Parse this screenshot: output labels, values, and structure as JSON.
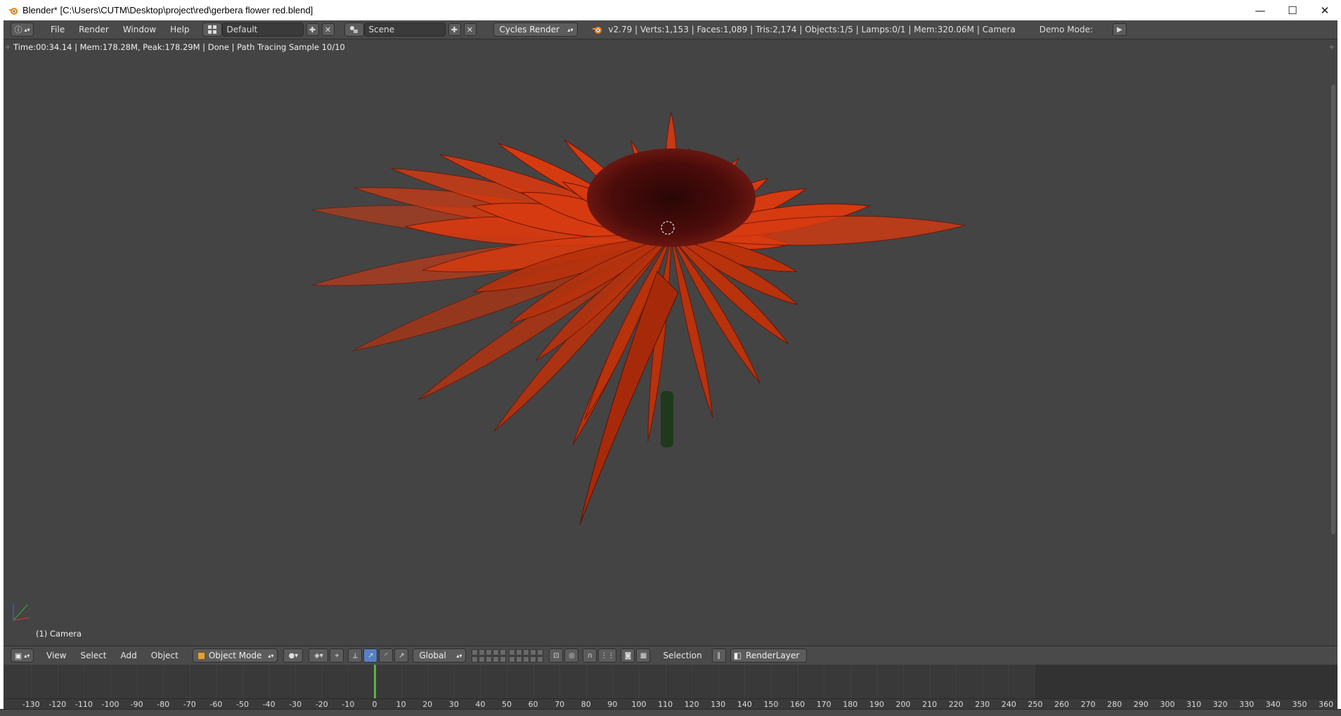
{
  "window": {
    "title": "Blender* [C:\\Users\\CUTM\\Desktop\\project\\red\\gerbera flower red.blend]",
    "minimize_glyph": "—",
    "maximize_glyph": "☐",
    "close_glyph": "✕"
  },
  "info_header": {
    "editor_glyph": "ⓘ",
    "menus": [
      "File",
      "Render",
      "Window",
      "Help"
    ],
    "screen_layout": "Default",
    "scene": "Scene",
    "render_engine": "Cycles Render",
    "stats": "v2.79 | Verts:1,153 | Faces:1,089 | Tris:2,174 | Objects:1/5 | Lamps:0/1 | Mem:320.06M | Camera",
    "demo_mode_label": "Demo Mode:"
  },
  "viewport": {
    "render_status": "Time:00:34.14 | Mem:178.28M, Peak:178.29M | Done | Path Tracing Sample 10/10",
    "camera_label": "(1) Camera",
    "petal_color": "#d63a10",
    "background_color": "#444444"
  },
  "view_header": {
    "menus": [
      "View",
      "Select",
      "Add",
      "Object"
    ],
    "mode": "Object Mode",
    "orientation": "Global",
    "selection_label": "Selection",
    "render_layer": "RenderLayer"
  },
  "timeline": {
    "current_frame": 0,
    "tick_labels": [
      "-130",
      "-120",
      "-110",
      "-100",
      "-90",
      "-80",
      "-70",
      "-60",
      "-50",
      "-40",
      "-30",
      "-20",
      "-10",
      "0",
      "10",
      "20",
      "30",
      "40",
      "50",
      "60",
      "70",
      "80",
      "90",
      "100",
      "110",
      "120",
      "130",
      "140",
      "150",
      "160",
      "170",
      "180",
      "190",
      "200",
      "210",
      "220",
      "230",
      "240",
      "250",
      "260",
      "270",
      "280",
      "290",
      "300",
      "310",
      "320",
      "330",
      "340",
      "350",
      "360"
    ]
  }
}
